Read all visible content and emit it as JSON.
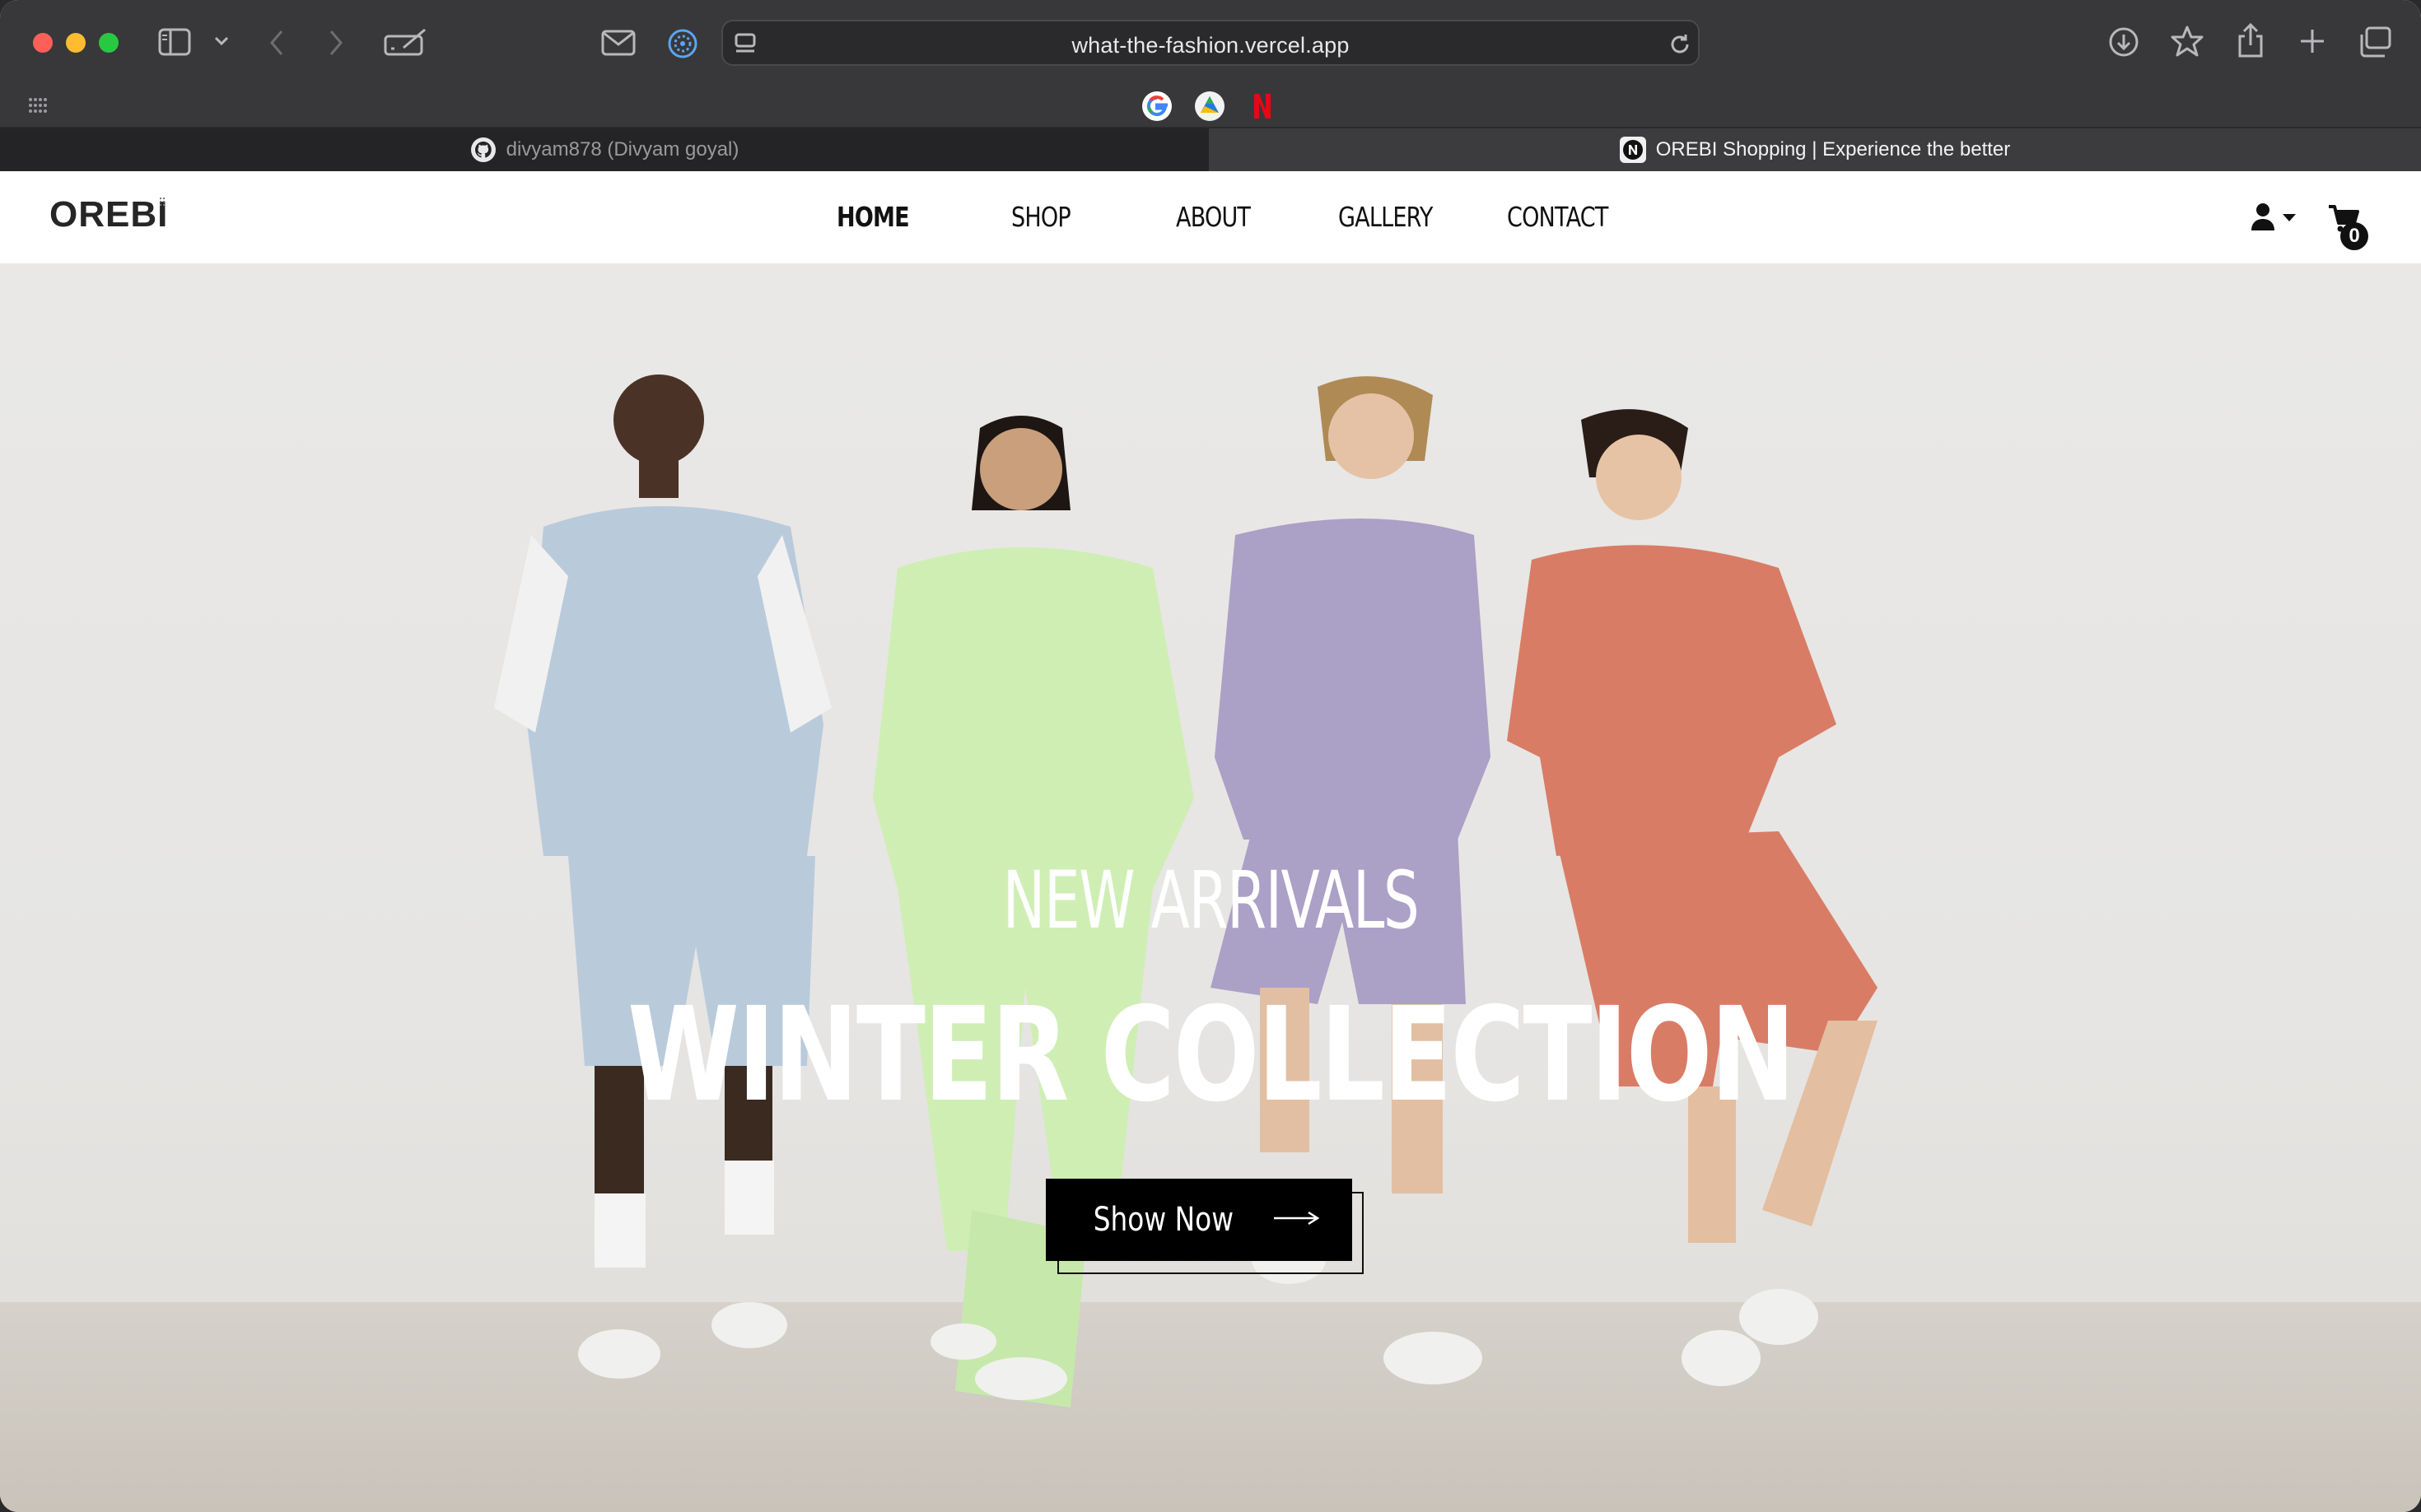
{
  "browser": {
    "url": "what-the-fashion.vercel.app",
    "toolbar_icons": [
      "sidebar-icon",
      "chevron-down-icon",
      "back-icon",
      "forward-icon",
      "compose-icon",
      "mail-icon",
      "compass-icon",
      "page-menu-icon",
      "reload-icon",
      "download-icon",
      "star-icon",
      "share-icon",
      "plus-icon",
      "tabs-overview-icon"
    ],
    "favorites": [
      "google-favicon",
      "drive-favicon",
      "netflix-favicon"
    ],
    "tabs": [
      {
        "label": "divyam878 (Divyam goyal)",
        "icon": "github-icon",
        "active": false
      },
      {
        "label": "OREBI Shopping | Experience the better",
        "icon": "n-icon",
        "active": true
      }
    ]
  },
  "site": {
    "logo": "OREBI",
    "nav": [
      "HOME",
      "SHOP",
      "ABOUT",
      "GALLERY",
      "CONTACT"
    ],
    "active_nav": "HOME",
    "cart_count": "0"
  },
  "hero": {
    "subtitle": "NEW ARRIVALS",
    "title": "WINTER COLLECTION",
    "cta_label": "Show Now",
    "colors": {
      "outfit_1": "#b9cadb",
      "outfit_2": "#cfeeb4",
      "outfit_3": "#aba0c6",
      "outfit_4": "#d97c66"
    }
  }
}
